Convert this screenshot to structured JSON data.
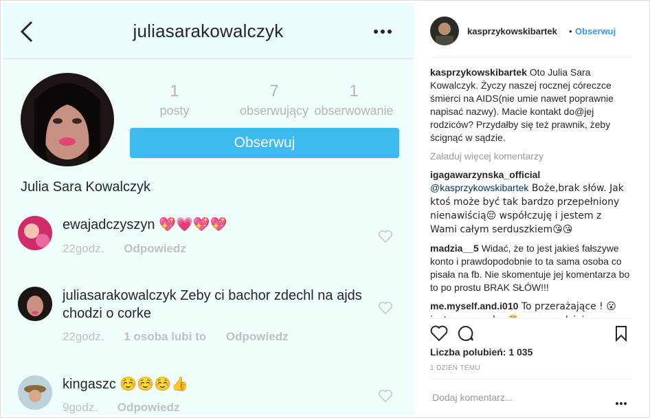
{
  "left": {
    "top_title": "juliasarakowalczyk",
    "stats": [
      {
        "num": "1",
        "label": "posty"
      },
      {
        "num": "7",
        "label": "obserwujący"
      },
      {
        "num": "1",
        "label": "obserwowanie"
      }
    ],
    "follow_label": "Obserwuj",
    "full_name": "Julia Sara Kowalczyk",
    "comments": [
      {
        "user": "ewajadczyszyn",
        "text": "💖💗💖💖",
        "time": "22godz.",
        "likes": "",
        "reply": "Odpowiedz"
      },
      {
        "user": "juliasarakowalczyk",
        "text": "Zeby ci bachor zdechl na ajds chodzi o corke",
        "time": "22godz.",
        "likes": "1 osoba lubi to",
        "reply": "Odpowiedz"
      },
      {
        "user": "kingaszc",
        "text": "☺️☺️☺️👍",
        "time": "9godz.",
        "likes": "",
        "reply": "Odpowiedz"
      }
    ]
  },
  "right": {
    "username": "kasprzykowskibartek",
    "dot": "•",
    "follow": "Obserwuj",
    "caption_user": "kasprzykowskibartek",
    "caption": "Oto Julia Sara Kowalczyk. Życzy naszej rocznej córeczce śmierci na AIDS(nie umie nawet poprawnie napisać nazwy). Macie kontakt do@jej rodziców? Przydałby się też prawnik, żeby ścignąć w sądzie.",
    "load_more": "Załaduj więcej komentarzy",
    "comments": [
      {
        "user": "igagawarzynska_official",
        "mention": "@kasprzykowskibartek",
        "text": " Boże,brak słów. Jak ktoś może być tak bardzo przepełniony nienawiścią😔 współczuję i jestem z Wami całym serduszkiem😘😘"
      },
      {
        "user": "madzia__5",
        "mention": "",
        "text": " Widać, że to jest jakieś fałszywe konto i prawdopodobnie to ta sama osoba co pisała na fb. Nie skomentuje jej komentarza bo to po prostu BRAK SŁÓW!!!"
      },
      {
        "user": "me.myself.and.i010",
        "mention": "",
        "text": " To przerażające ! 😮 jestem w szoku 😤 mam nadzieje ze autorka posta zostanie należycie ukarana !!!"
      }
    ],
    "likes": "Liczba polubień: 1 035",
    "time": "1 DZIEŃ TEMU",
    "add_comment": "Dodaj komentarz..."
  }
}
